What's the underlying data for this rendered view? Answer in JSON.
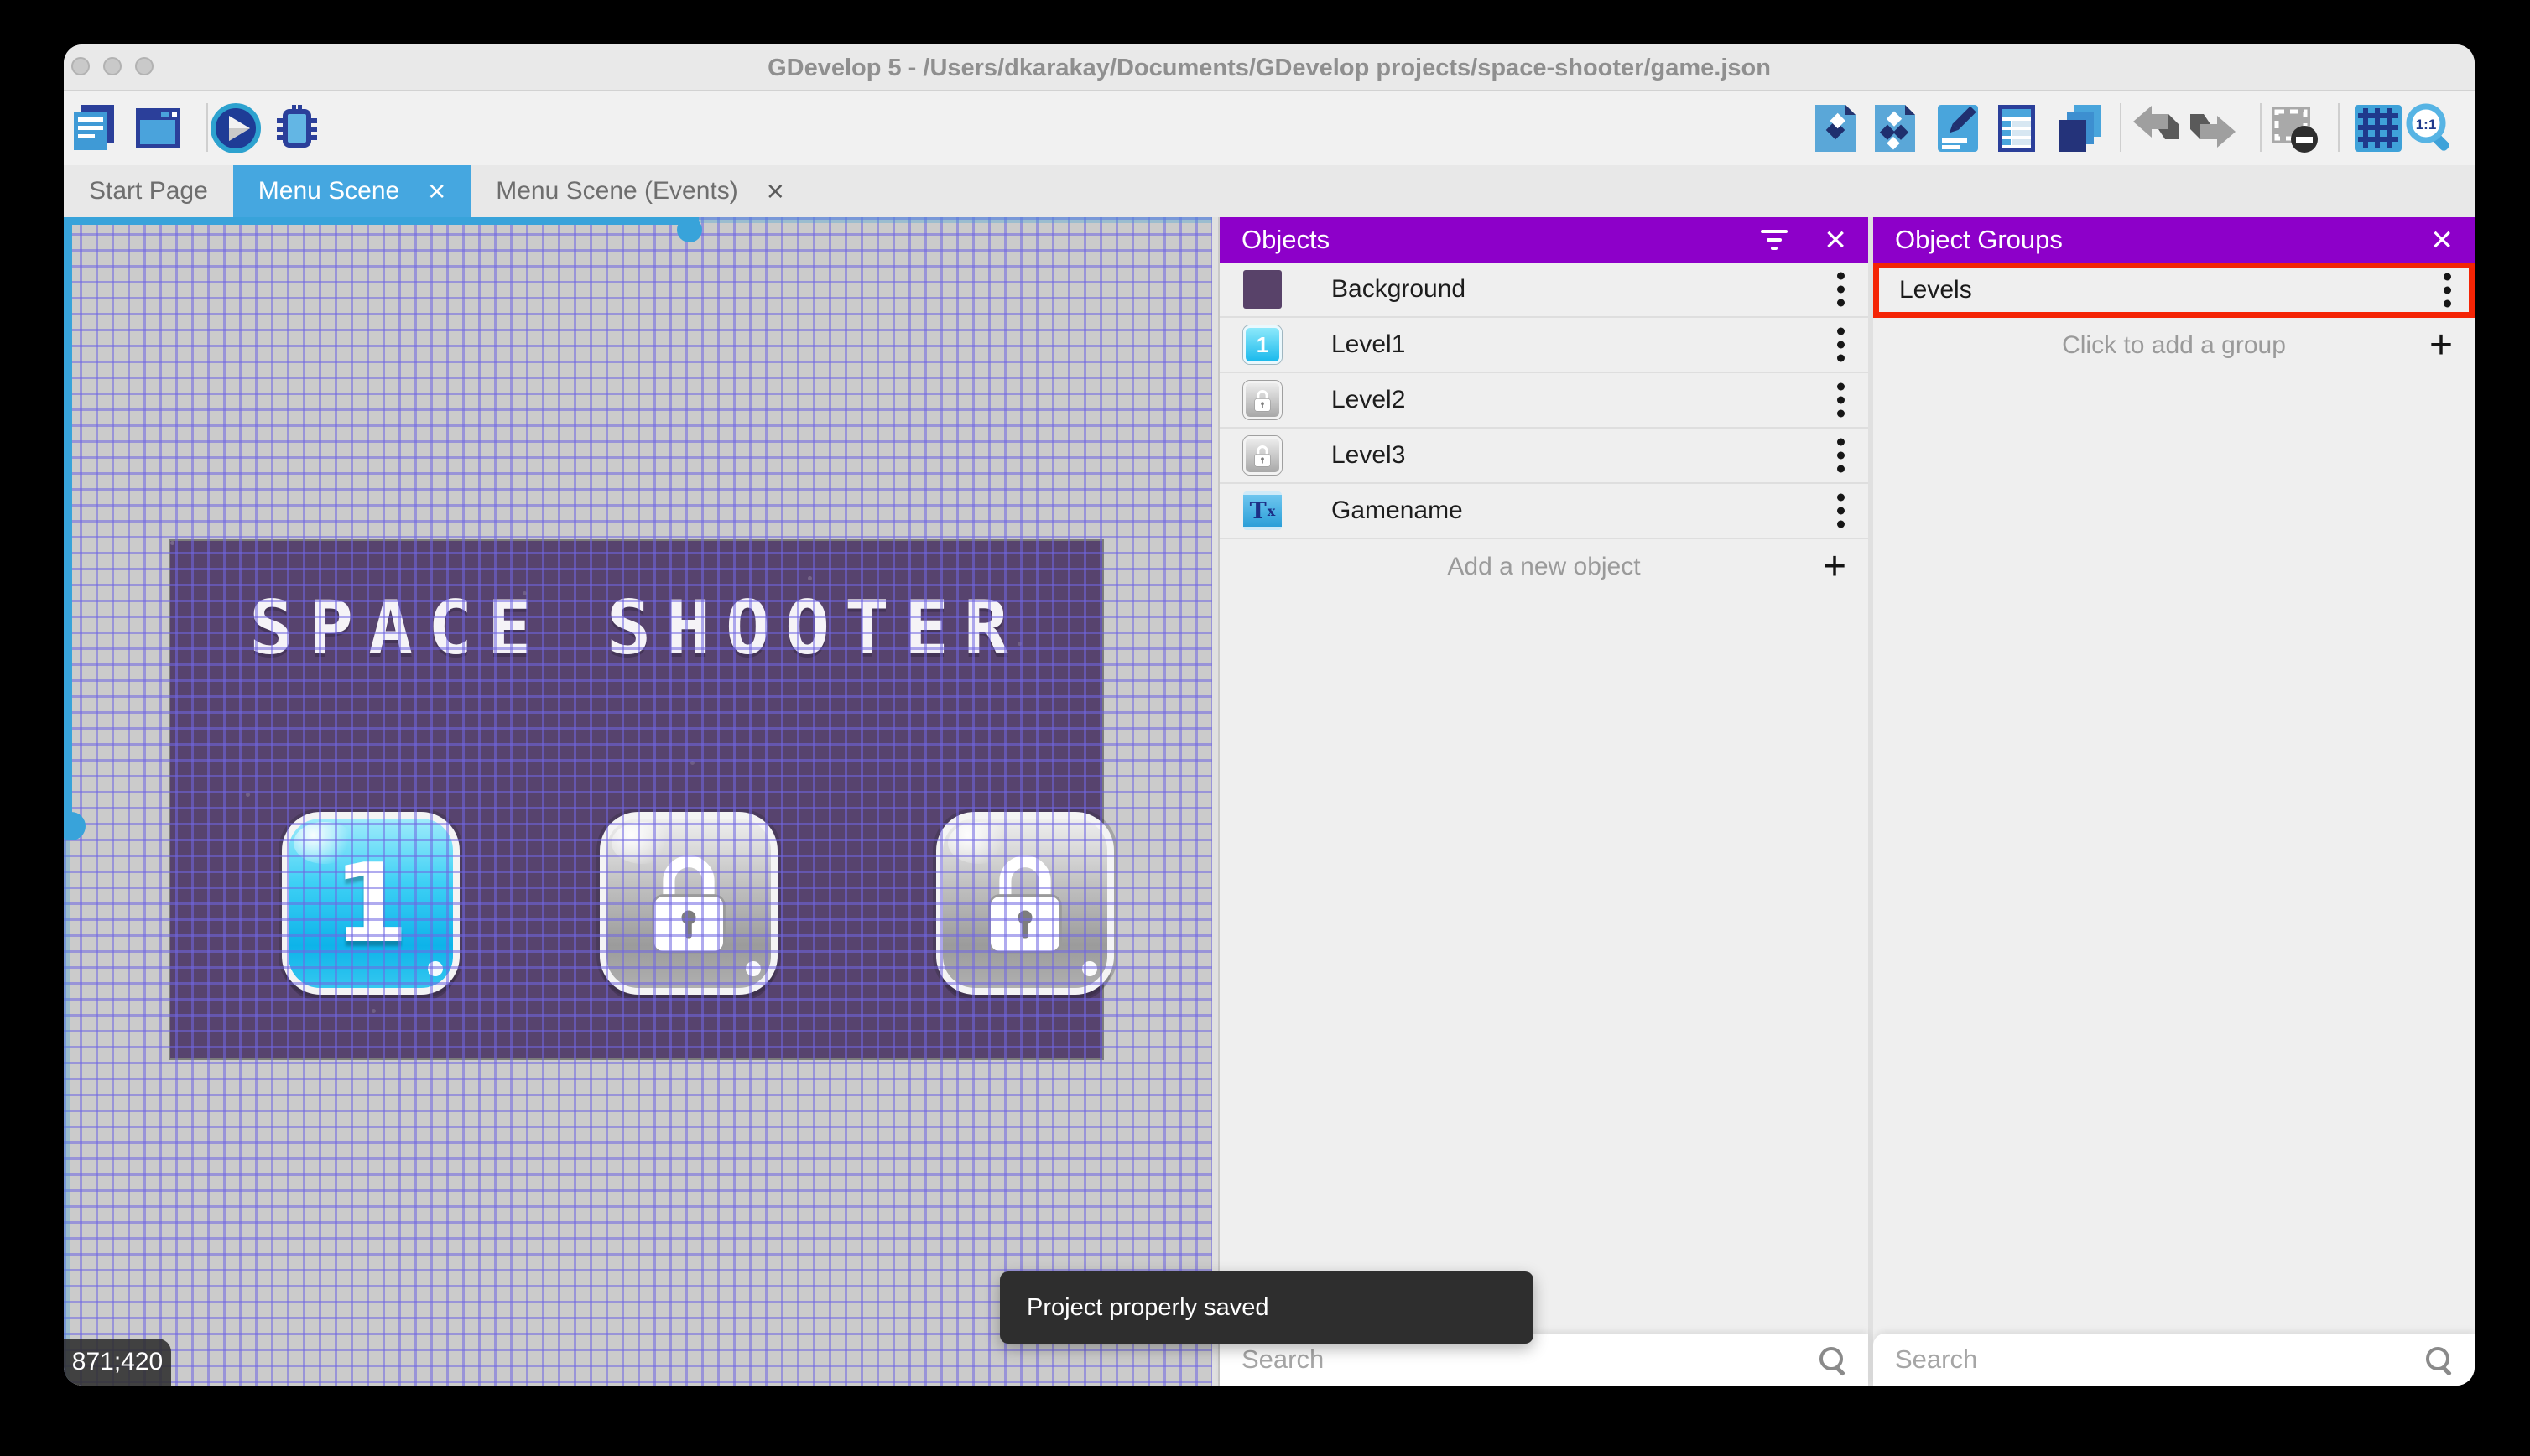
{
  "window": {
    "title": "GDevelop 5 - /Users/dkarakay/Documents/GDevelop projects/space-shooter/game.json",
    "toast": "Project properly saved",
    "coords": "871;420"
  },
  "tabs": [
    {
      "label": "Start Page",
      "active": false,
      "closable": false
    },
    {
      "label": "Menu Scene",
      "active": true,
      "closable": true
    },
    {
      "label": "Menu Scene (Events)",
      "active": false,
      "closable": true
    }
  ],
  "toolbar": {
    "left_icons": [
      "project-manager-icon",
      "scene-window-icon",
      "play-icon",
      "debug-icon"
    ],
    "right_icons": [
      "add-object-icon",
      "object-groups-icon",
      "properties-icon",
      "instances-list-icon",
      "layers-icon",
      "undo-icon",
      "redo-icon",
      "mask-icon",
      "grid-icon",
      "zoom-1-1-icon"
    ]
  },
  "scene": {
    "title": "SPACE SHOOTER",
    "levels": [
      {
        "label": "1",
        "locked": false
      },
      {
        "label": "",
        "locked": true
      },
      {
        "label": "",
        "locked": true
      }
    ]
  },
  "objects_panel": {
    "title": "Objects",
    "items": [
      {
        "name": "Background",
        "thumb": "background"
      },
      {
        "name": "Level1",
        "thumb": "level-blue"
      },
      {
        "name": "Level2",
        "thumb": "level-locked"
      },
      {
        "name": "Level3",
        "thumb": "level-locked"
      },
      {
        "name": "Gamename",
        "thumb": "text-object"
      }
    ],
    "add_label": "Add a new object",
    "search_placeholder": "Search"
  },
  "groups_panel": {
    "title": "Object Groups",
    "items": [
      {
        "name": "Levels",
        "highlighted": true
      }
    ],
    "add_label": "Click to add a group",
    "search_placeholder": "Search"
  },
  "colors": {
    "panel_header_purple": "#8d00c9",
    "active_tab_blue": "#45a7e0",
    "highlight_red": "#f42405",
    "toast_bg": "#2e2e2e",
    "scene_bg": "#57436e",
    "grid_line": "#7066e2",
    "scrollbar_blue": "#38a3da"
  }
}
